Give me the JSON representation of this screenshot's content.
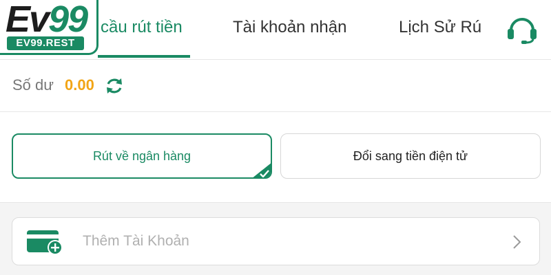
{
  "brand": {
    "logo_text_ev": "Ev",
    "logo_text_num": "99",
    "logo_badge": "EV99.REST",
    "color_primary": "#1a8a63",
    "color_accent": "#f2a516"
  },
  "tabs": [
    {
      "label": "cầu rút tiền",
      "active": true
    },
    {
      "label": "Tài khoản nhận",
      "active": false
    },
    {
      "label": "Lịch Sử Rú",
      "active": false
    }
  ],
  "header": {
    "support_icon": "headset-icon"
  },
  "balance": {
    "label": "Số dư",
    "value": "0.00",
    "refresh_icon": "refresh-icon"
  },
  "methods": [
    {
      "label": "Rút về ngân hàng",
      "selected": true
    },
    {
      "label": "Đổi sang tiền điện tử",
      "selected": false
    }
  ],
  "add_account": {
    "label": "Thêm Tài Khoản",
    "icon": "card-add-icon",
    "chevron": "chevron-right-icon"
  }
}
